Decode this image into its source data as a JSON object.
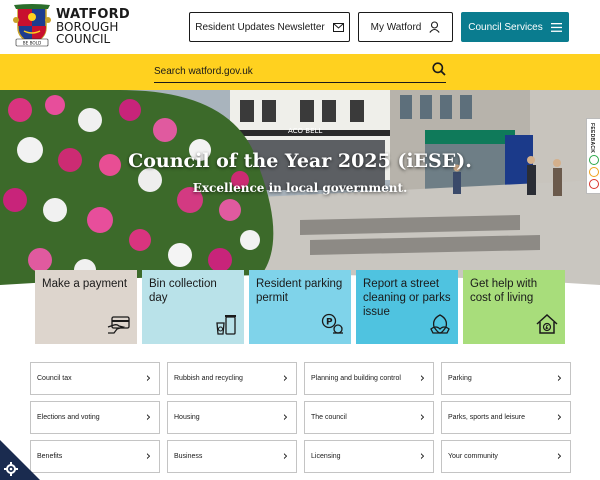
{
  "header": {
    "logo_line1": "WATFORD",
    "logo_line2": "BOROUGH",
    "logo_line3": "COUNCIL",
    "crest_motto": "BE BOLD",
    "newsletter_label": "Resident Updates Newsletter",
    "mywatford_label": "My Watford",
    "services_label": "Council Services"
  },
  "search": {
    "placeholder": "Search watford.gov.uk"
  },
  "hero": {
    "title": "Council of the Year 2025 (iESE).",
    "subtitle": "Excellence in local government."
  },
  "feedback": {
    "label": "FEEDBACK"
  },
  "tiles": [
    {
      "label": "Make a payment",
      "color": "#ddd5cd",
      "icon": "card-payment-icon"
    },
    {
      "label": "Bin collection day",
      "color": "#b9e2e9",
      "icon": "bins-icon"
    },
    {
      "label": "Resident parking permit",
      "color": "#7fd3ea",
      "icon": "parking-permit-icon"
    },
    {
      "label": "Report a street cleaning or parks issue",
      "color": "#4fc3e0",
      "icon": "street-cleaning-icon"
    },
    {
      "label": "Get help with cost of living",
      "color": "#a8dd7b",
      "icon": "home-money-icon"
    }
  ],
  "links": [
    "Council tax",
    "Rubbish and recycling",
    "Planning and building control",
    "Parking",
    "Elections and voting",
    "Housing",
    "The council",
    "Parks, sports and leisure",
    "Benefits",
    "Business",
    "Licensing",
    "Your community"
  ],
  "colors": {
    "accent_teal": "#0a7c8f",
    "search_yellow": "#ffd11f",
    "cookie_navy": "#1a2b4f"
  }
}
